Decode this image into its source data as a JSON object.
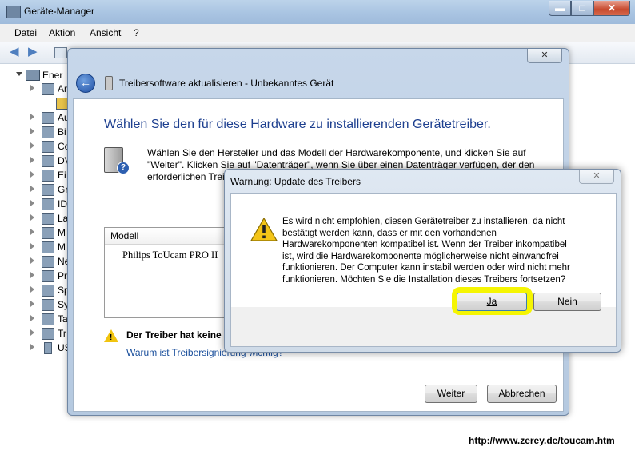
{
  "main_window": {
    "title": "Geräte-Manager",
    "caption": {
      "minimize": "▬",
      "maximize": "□",
      "close": "✕"
    },
    "menu": [
      "Datei",
      "Aktion",
      "Ansicht",
      "?"
    ],
    "tree": {
      "root_label": "Ener",
      "items": [
        "An",
        "",
        "Au",
        "Bi",
        "Co",
        "DV",
        "Ei",
        "Gr",
        "ID",
        "La",
        "M",
        "M",
        "Ne",
        "Pr",
        "Sp",
        "Sy",
        "Ta",
        "Tr",
        "US"
      ]
    }
  },
  "wizard": {
    "close": "✕",
    "back": "←",
    "title": "Treibersoftware aktualisieren - Unbekanntes Gerät",
    "heading": "Wählen Sie den für diese Hardware zu installierenden Gerätetreiber.",
    "instruction_lines": [
      "Wählen Sie den Hersteller und das Modell der Hardwarekomponente, und klicken Sie auf",
      "\"Weiter\". Klicken Sie auf \"Datenträger\", wenn Sie über einen Datenträger verfügen, der den",
      "erforderlichen Trei"
    ],
    "model_header": "Modell",
    "model_item": "Philips ToUcam PRO II",
    "driver_warning": "Der Treiber hat keine",
    "link": "Warum ist Treibersignierung wichtig?",
    "next_button": "Weiter",
    "cancel_button": "Abbrechen"
  },
  "warning_dialog": {
    "title": "Warnung: Update des Treibers",
    "close": "✕",
    "message_lines": [
      "Es wird nicht empfohlen, diesen Gerätetreiber zu installieren, da nicht",
      "bestätigt werden kann, dass er mit den vorhandenen",
      "Hardwarekomponenten kompatibel ist.  Wenn der Treiber inkompatibel",
      "ist, wird die Hardwarekomponente möglicherweise nicht einwandfrei",
      "funktionieren. Der Computer kann instabil werden oder wird nicht mehr",
      "funktionieren.  Möchten Sie die Installation dieses Treibers fortsetzen?"
    ],
    "yes_button": "Ja",
    "no_button": "Nein",
    "highlight_color": "#f5f502"
  },
  "footer_url": "http://www.zerey.de/toucam.htm"
}
